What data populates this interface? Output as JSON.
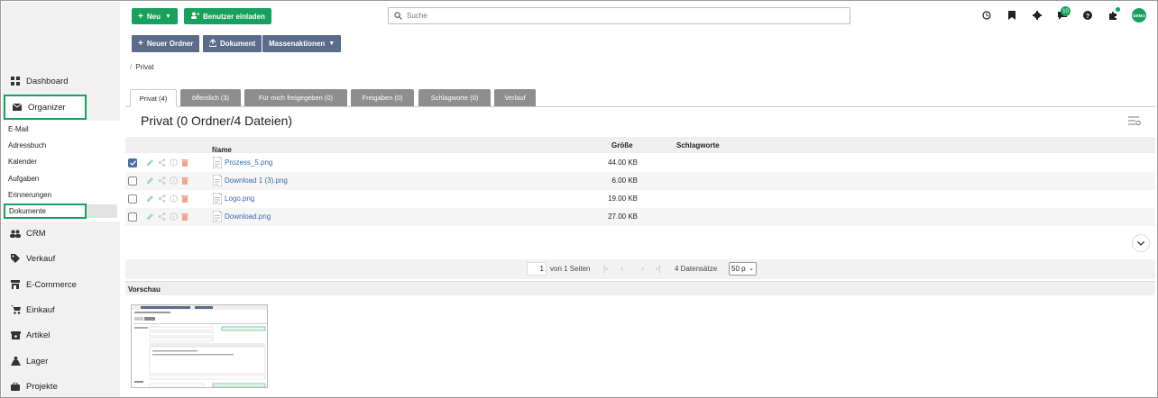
{
  "sidebar": {
    "dashboard": "Dashboard",
    "organizer": "Organizer",
    "sub_items": [
      "E-Mail",
      "Adressbuch",
      "Kalender",
      "Aufgaben",
      "Erinnerungen",
      "Dokumente"
    ],
    "sections": [
      "CRM",
      "Verkauf",
      "E-Commerce",
      "Einkauf",
      "Artikel",
      "Lager",
      "Projekte"
    ]
  },
  "toolbar": {
    "new_label": "Neu",
    "invite_label": "Benutzer einladen",
    "search_placeholder": "Suche",
    "notification_count": "10",
    "avatar_text": "DEMO",
    "new_folder_label": "Neuer Ordner",
    "document_label": "Dokument",
    "bulk_label": "Massenaktionen"
  },
  "breadcrumb": "Privat",
  "tabs": [
    {
      "label": "Privat (4)",
      "active": true
    },
    {
      "label": "öffentlich (3)",
      "active": false
    },
    {
      "label": "Für mich freigegeben (0)",
      "active": false
    },
    {
      "label": "Freigaben (0)",
      "active": false
    },
    {
      "label": "Schlagworte (0)",
      "active": false
    },
    {
      "label": "Verlauf",
      "active": false
    }
  ],
  "title": "Privat (0 Ordner/4 Dateien)",
  "table": {
    "headers": {
      "name": "Name",
      "size": "Größe",
      "tags": "Schlagworte"
    },
    "rows": [
      {
        "name": "Prozess_5.png",
        "size": "44.00 KB",
        "checked": true
      },
      {
        "name": "Download 1 (3).png",
        "size": "6.00 KB",
        "checked": false
      },
      {
        "name": "Logo.png",
        "size": "19.00 KB",
        "checked": false
      },
      {
        "name": "Download.png",
        "size": "27.00 KB",
        "checked": false
      }
    ]
  },
  "pager": {
    "page": "1",
    "of_pages": "von 1 Seiten",
    "records": "4 Datensätze",
    "per_page": "50 p"
  },
  "preview_label": "Vorschau",
  "colors": {
    "accent": "#18a05d",
    "blue_button": "#5a6b8c",
    "link": "#3a6aa8"
  }
}
